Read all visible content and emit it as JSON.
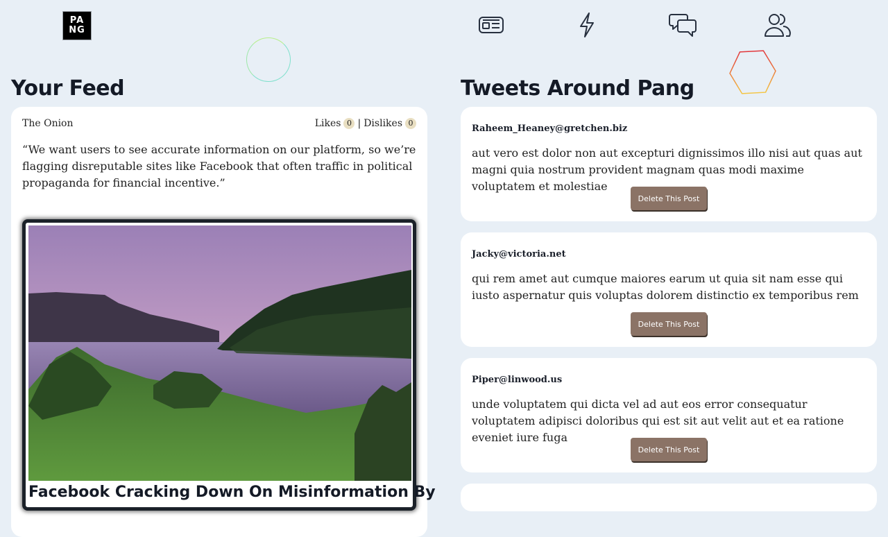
{
  "logo": {
    "line1": "PA",
    "line2": "NG"
  },
  "nav": {
    "items": [
      {
        "icon": "news-icon"
      },
      {
        "icon": "lightning-icon"
      },
      {
        "icon": "chat-bubbles-icon"
      },
      {
        "icon": "users-icon"
      }
    ]
  },
  "feed": {
    "heading": "Your Feed",
    "post": {
      "source": "The Onion",
      "likes_label": "Likes",
      "likes_count": "0",
      "separator": "|",
      "dislikes_label": "Dislikes",
      "dislikes_count": "0",
      "quote": "“We want users to see accurate information on our platform, so we’re flagging disreputable sites like Facebook that often traffic in political propaganda for financial incentive.”",
      "article_title": "Facebook Cracking Down On Misinformation By"
    }
  },
  "tweets": {
    "heading": "Tweets Around Pang",
    "items": [
      {
        "user": "Raheem_Heaney@gretchen.biz",
        "text": "aut vero est dolor non aut excepturi dignissimos illo nisi aut quas aut magni quia nostrum provident magnam quas modi maxime voluptatem et molestiae",
        "button": "Delete This Post"
      },
      {
        "user": "Jacky@victoria.net",
        "text": "qui rem amet aut cumque maiores earum ut quia sit nam esse qui iusto aspernatur quis voluptas dolorem distinctio ex temporibus rem",
        "button": "Delete This Post"
      },
      {
        "user": "Piper@linwood.us",
        "text": "unde voluptatem qui dicta vel ad aut eos error consequatur voluptatem adipisci doloribus qui est sit aut velit aut et ea ratione eveniet iure fuga",
        "button": "Delete This Post"
      }
    ]
  }
}
